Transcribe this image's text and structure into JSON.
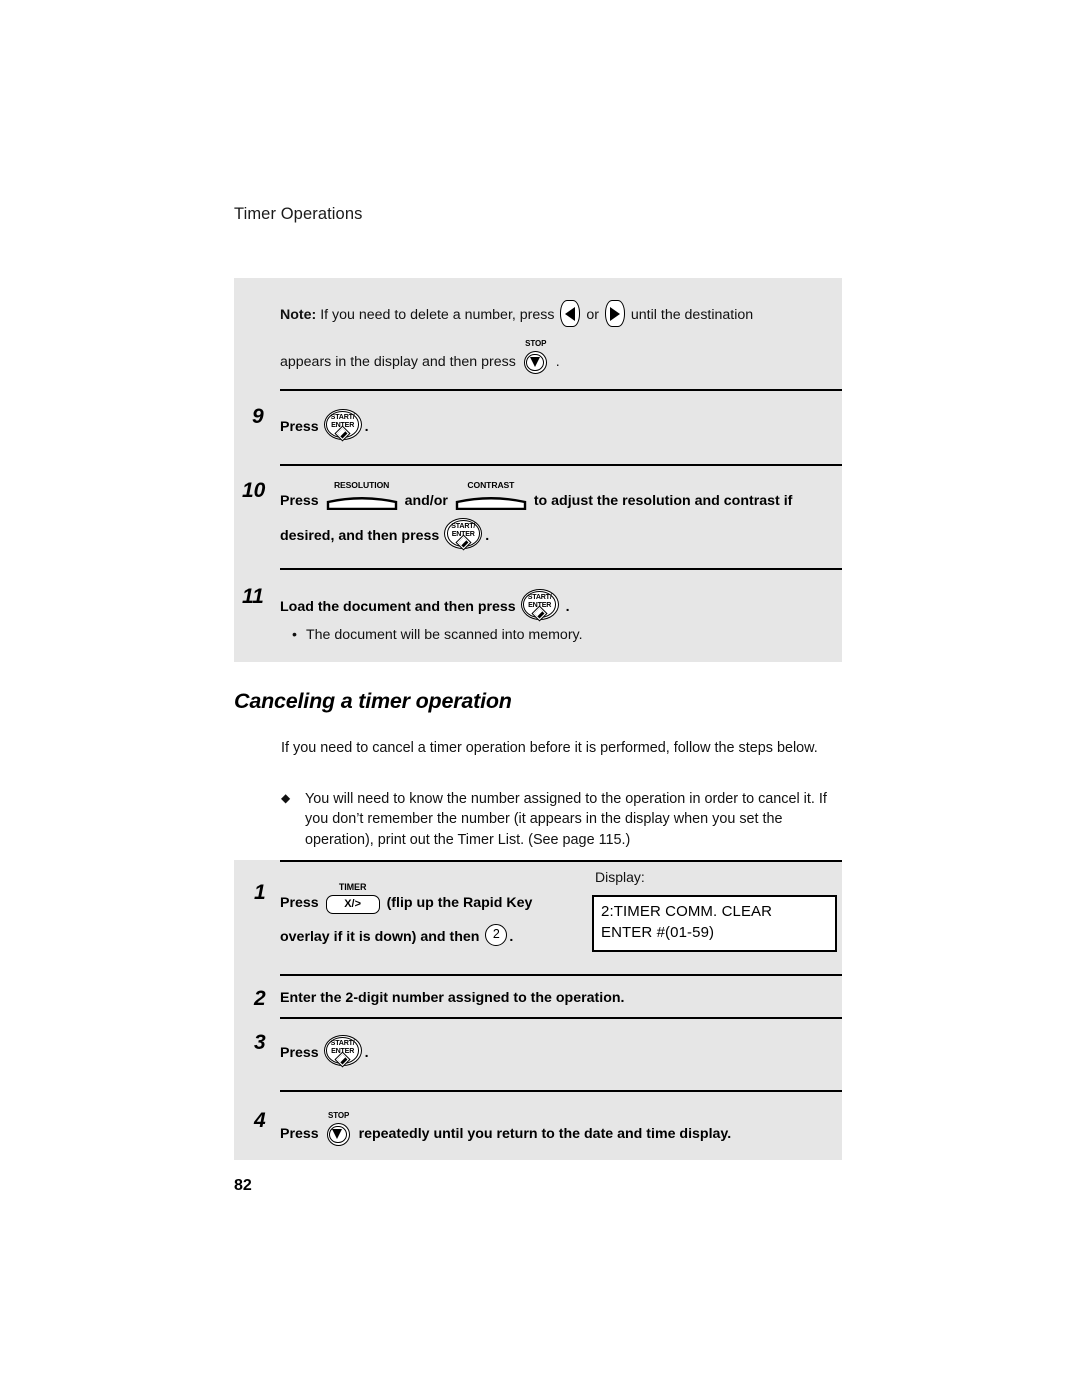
{
  "running_head": "Timer Operations",
  "note": {
    "label": "Note:",
    "text_part1": "If you need to delete a number, press",
    "or_word": "or",
    "text_part2": "until the destination",
    "text_part3": "appears in the display and then press",
    "period": "."
  },
  "keys": {
    "start_enter": {
      "line1": "START/",
      "line2": "ENTER",
      "name": "START/ENTER"
    },
    "stop": {
      "label": "STOP",
      "name": "STOP"
    },
    "arrow_left": {
      "name": "left arrow"
    },
    "arrow_right": {
      "name": "right arrow"
    },
    "resolution": {
      "label": "RESOLUTION"
    },
    "contrast": {
      "label": "CONTRAST"
    },
    "timer": {
      "label": "TIMER",
      "text": "X/>"
    },
    "digit_two": {
      "text": "2"
    }
  },
  "steps_top": [
    {
      "number": "9",
      "text_before": "Press",
      "text_after": "."
    },
    {
      "number": "10",
      "line1_before": "Press",
      "line1_middle": "and/or",
      "line1_after": "to adjust the resolution and contrast if",
      "line2_before": "desired, and then press",
      "line2_after": "."
    },
    {
      "number": "11",
      "text_before": "Load the document and then press",
      "text_after": ".",
      "bullet": "The document will be scanned into memory."
    }
  ],
  "section_heading": "Canceling a timer operation",
  "intro_paragraph": "If you need to cancel a timer operation before it is performed, follow the steps below.",
  "diamond_bullet": "You will need to know the number assigned to the operation in order to cancel it. If you don’t remember the number (it appears in the display when you set the operation), print out the Timer List. (See page 115.)",
  "steps_bottom": [
    {
      "number": "1",
      "line1_before": "Press",
      "line1_after": "(flip up the Rapid Key",
      "line2_before": "overlay if it is down) and then",
      "line2_after": "."
    },
    {
      "number": "2",
      "text": "Enter the 2-digit number assigned to the operation."
    },
    {
      "number": "3",
      "text_before": "Press",
      "text_after": "."
    },
    {
      "number": "4",
      "text_before": "Press",
      "text_after": "repeatedly until you return to the date and time display."
    }
  ],
  "display_callout": {
    "label": "Display:",
    "line1": "2:TIMER COMM. CLEAR",
    "line2": "ENTER #(01-59)"
  },
  "page_number": "82",
  "colors": {
    "panel_gray": "#e6e6e6",
    "text": "#000000",
    "page_background": "#ffffff"
  }
}
